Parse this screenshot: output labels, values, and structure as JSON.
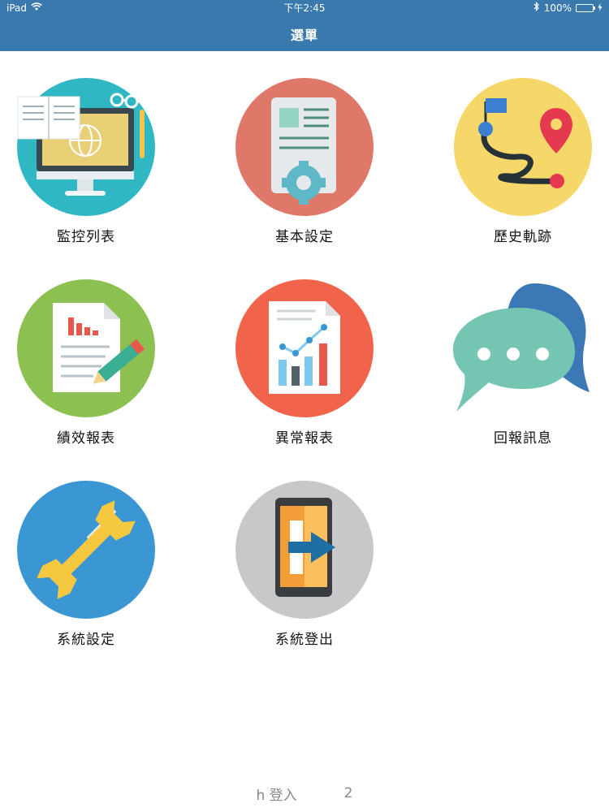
{
  "status_bar": {
    "device": "iPad",
    "time": "下午2:45",
    "battery_percent": "100%"
  },
  "header": {
    "title": "選單"
  },
  "menu": {
    "items": [
      {
        "label": "監控列表",
        "icon": "monitor-list-icon"
      },
      {
        "label": "基本設定",
        "icon": "basic-settings-icon"
      },
      {
        "label": "歷史軌跡",
        "icon": "history-route-icon"
      },
      {
        "label": "績效報表",
        "icon": "performance-report-icon"
      },
      {
        "label": "異常報表",
        "icon": "anomaly-report-icon"
      },
      {
        "label": "回報訊息",
        "icon": "chat-bubble-icon"
      },
      {
        "label": "系統設定",
        "icon": "tools-icon"
      },
      {
        "label": "系統登出",
        "icon": "logout-icon"
      }
    ]
  },
  "footer": {
    "login_text": "h 登入",
    "number_text": "2"
  },
  "colors": {
    "header_bg": "#3a79ad",
    "teal": "#2fb7c3",
    "salmon": "#e0786a",
    "yellow": "#f6d86a",
    "green": "#8cc152",
    "red_orange": "#f2634b",
    "blue": "#3b97d3",
    "gray": "#c8c7c9"
  }
}
